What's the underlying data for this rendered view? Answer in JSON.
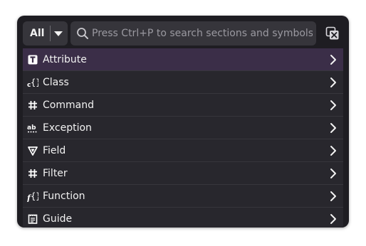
{
  "filter": {
    "label": "All",
    "icon": "chevron-down-icon"
  },
  "search": {
    "placeholder": "Press Ctrl+P to search sections and symbols",
    "value": ""
  },
  "clear_button": {
    "icon": "clear-search-icon"
  },
  "rows": [
    {
      "label": "Attribute",
      "icon": "attribute-icon",
      "selected": true
    },
    {
      "label": "Class",
      "icon": "class-icon",
      "selected": false
    },
    {
      "label": "Command",
      "icon": "command-icon",
      "selected": false
    },
    {
      "label": "Exception",
      "icon": "exception-icon",
      "selected": false
    },
    {
      "label": "Field",
      "icon": "field-icon",
      "selected": false
    },
    {
      "label": "Filter",
      "icon": "filter-icon",
      "selected": false
    },
    {
      "label": "Function",
      "icon": "function-icon",
      "selected": false
    },
    {
      "label": "Guide",
      "icon": "guide-icon",
      "selected": false
    }
  ],
  "colors": {
    "panel": "#1e1d22",
    "row": "#28272d",
    "selected_row": "#3b2e48",
    "field": "#36353b",
    "text": "#f2f2f2",
    "placeholder": "#9a99a0"
  }
}
